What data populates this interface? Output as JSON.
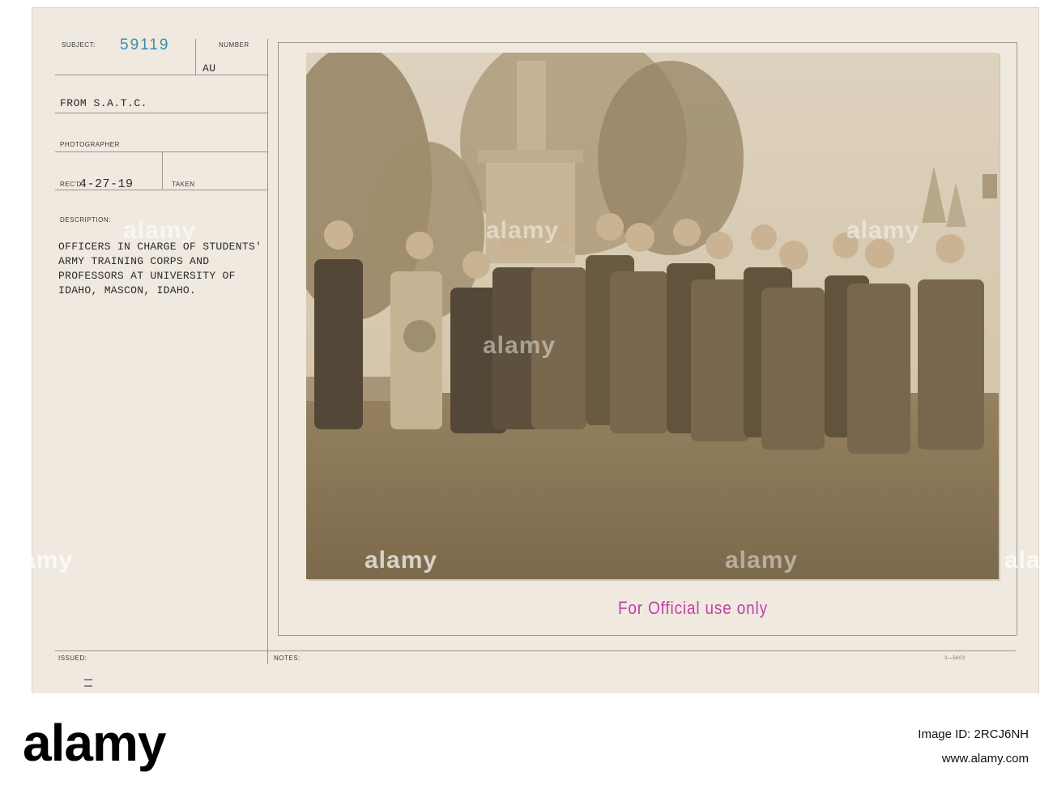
{
  "card": {
    "subject_label": "SUBJECT:",
    "subject_number": "59119",
    "number_label": "NUMBER",
    "au_code": "AU",
    "from_line": "FROM S.A.T.C.",
    "photographer_label": "PHOTOGRAPHER",
    "recd_label": "REC'D",
    "recd_date": "4-27-19",
    "taken_label": "TAKEN",
    "description_label": "DESCRIPTION:",
    "description_lines": [
      "OFFICERS IN CHARGE OF STUDENTS'",
      "ARMY TRAINING CORPS AND",
      "PROFESSORS AT UNIVERSITY OF",
      "IDAHO, MASCON, IDAHO."
    ],
    "issued_label": "ISSUED:",
    "notes_label": "NOTES:",
    "form_code": "3—5603",
    "official_stamp": "For Official use only"
  },
  "watermark": {
    "text": "alamy"
  },
  "footer": {
    "logo": "alamy",
    "image_id_label": "Image ID: 2RCJ6NH",
    "site": "www.alamy.com"
  },
  "colors": {
    "card": "#efe9df",
    "stamp_blue": "#3c8bb0",
    "official_magenta": "#c040a8",
    "sepia": "#b7a585"
  }
}
